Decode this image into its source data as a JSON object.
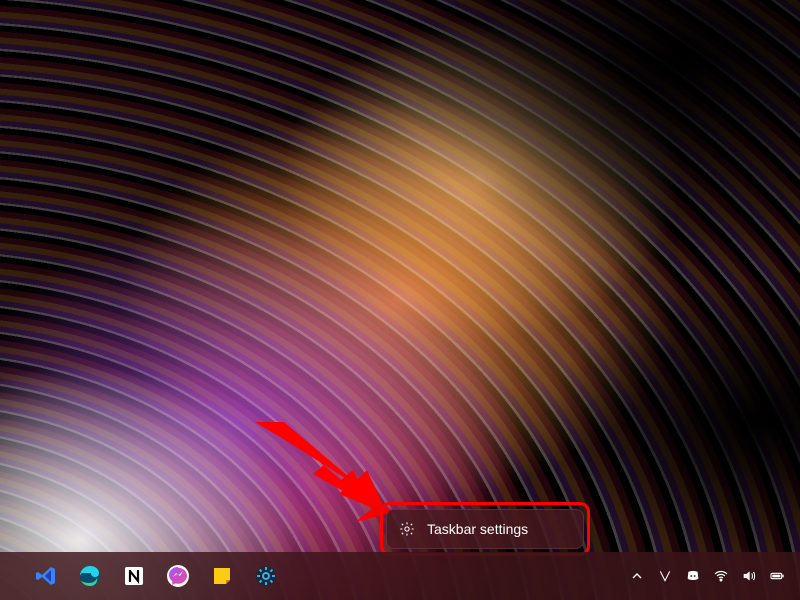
{
  "context_menu": {
    "label": "Taskbar settings"
  },
  "taskbar": {
    "apps": [
      {
        "name": "vscode"
      },
      {
        "name": "edge"
      },
      {
        "name": "notion"
      },
      {
        "name": "messenger"
      },
      {
        "name": "sticky-notes"
      },
      {
        "name": "settings"
      }
    ]
  },
  "tray": {
    "items": [
      {
        "name": "overflow-chevron"
      },
      {
        "name": "v-app"
      },
      {
        "name": "discord"
      },
      {
        "name": "wifi"
      },
      {
        "name": "volume"
      },
      {
        "name": "battery"
      }
    ]
  },
  "annotation": {
    "arrow_color": "#ff0000",
    "highlight_color": "#ff0000"
  }
}
